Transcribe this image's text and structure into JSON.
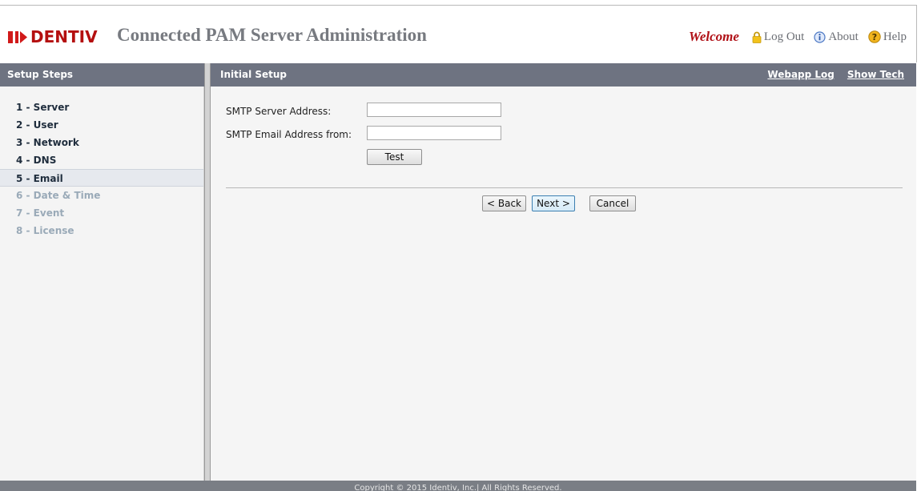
{
  "header": {
    "brand": "I▶ENTIV",
    "brand_text": "DENTIV",
    "title": "Connected PAM Server Administration",
    "welcome": "Welcome",
    "logout": "Log Out",
    "about": "About",
    "help": "Help",
    "brand_color": "#b40f0f",
    "accent_color": "#b01016"
  },
  "left_panel": {
    "title": "Setup Steps",
    "steps": [
      {
        "label": "1 - Server",
        "state": "enabled"
      },
      {
        "label": "2 - User",
        "state": "enabled"
      },
      {
        "label": "3 - Network",
        "state": "enabled"
      },
      {
        "label": "4 - DNS",
        "state": "enabled"
      },
      {
        "label": "5 - Email",
        "state": "active"
      },
      {
        "label": "6 - Date & Time",
        "state": "disabled"
      },
      {
        "label": "7 - Event",
        "state": "disabled"
      },
      {
        "label": "8 - License",
        "state": "disabled"
      }
    ]
  },
  "right_panel": {
    "title": "Initial Setup",
    "webapp_log": "Webapp Log",
    "show_tech": "Show Tech"
  },
  "form": {
    "smtp_server_label": "SMTP Server Address:",
    "smtp_server_value": "",
    "smtp_email_label": "SMTP Email Address from:",
    "smtp_email_value": "",
    "test_button": "Test"
  },
  "nav": {
    "back": "< Back",
    "next": "Next >",
    "cancel": "Cancel"
  },
  "footer": {
    "copyright": "Copyright © 2015 Identiv, Inc.| All Rights Reserved."
  },
  "icons": {
    "logout": "lock-icon",
    "about": "info-icon",
    "help": "help-icon"
  }
}
